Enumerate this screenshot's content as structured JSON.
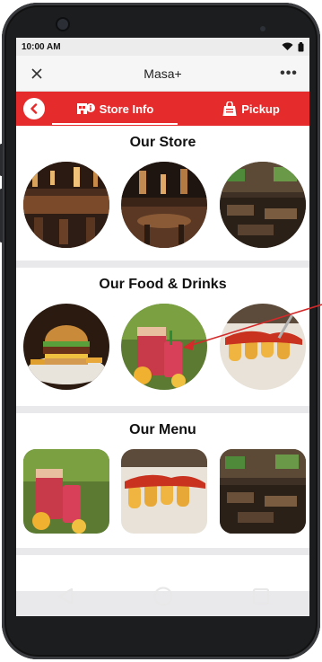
{
  "status_bar": {
    "time": "10:00 AM"
  },
  "app_bar": {
    "title": "Masa+",
    "more_label": "•••"
  },
  "tabs": [
    {
      "label": "Store Info",
      "active": true
    },
    {
      "label": "Pickup",
      "active": false
    }
  ],
  "sections": [
    {
      "title": "Our Store"
    },
    {
      "title": "Our Food & Drinks"
    },
    {
      "title": "Our Menu"
    }
  ],
  "colors": {
    "accent": "#e52b2b",
    "annotation_arrow": "#d42a2a"
  }
}
